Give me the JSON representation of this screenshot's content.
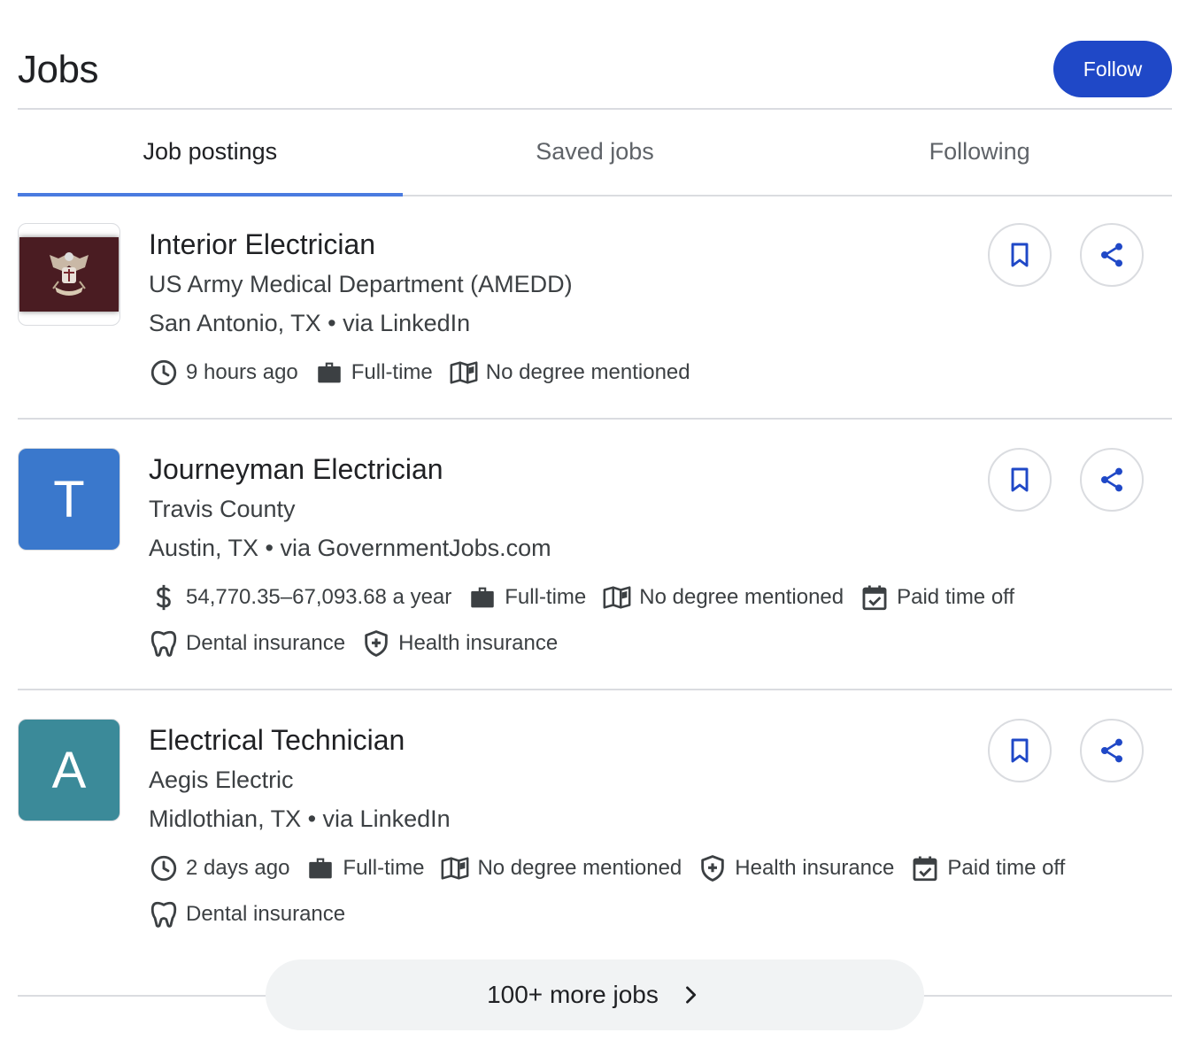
{
  "header": {
    "title": "Jobs",
    "follow_label": "Follow"
  },
  "tabs": [
    {
      "label": "Job postings",
      "active": true
    },
    {
      "label": "Saved jobs",
      "active": false
    },
    {
      "label": "Following",
      "active": false
    }
  ],
  "jobs": [
    {
      "title": "Interior Electrician",
      "company": "US Army Medical Department (AMEDD)",
      "location": "San Antonio, TX • via LinkedIn",
      "logo": {
        "type": "image",
        "icon": "army-crest-logo"
      },
      "chips_row1": [
        {
          "icon": "clock-icon",
          "text": "9 hours ago"
        },
        {
          "icon": "briefcase-icon",
          "text": "Full-time"
        },
        {
          "icon": "book-icon",
          "text": "No degree mentioned"
        }
      ],
      "chips_row2": []
    },
    {
      "title": "Journeyman Electrician",
      "company": "Travis County",
      "location": "Austin, TX • via GovernmentJobs.com",
      "logo": {
        "type": "letter",
        "letter": "T",
        "color": "#3a78cc"
      },
      "chips_row1": [
        {
          "icon": "dollar-icon",
          "text": "54,770.35–67,093.68 a year"
        },
        {
          "icon": "briefcase-icon",
          "text": "Full-time"
        },
        {
          "icon": "book-icon",
          "text": "No degree mentioned"
        },
        {
          "icon": "calendar-check-icon",
          "text": "Paid time off"
        }
      ],
      "chips_row2": [
        {
          "icon": "tooth-icon",
          "text": "Dental insurance"
        },
        {
          "icon": "shield-plus-icon",
          "text": "Health insurance"
        }
      ]
    },
    {
      "title": "Electrical Technician",
      "company": "Aegis Electric",
      "location": "Midlothian, TX • via LinkedIn",
      "logo": {
        "type": "letter",
        "letter": "A",
        "color": "#3b8a99"
      },
      "chips_row1": [
        {
          "icon": "clock-icon",
          "text": "2 days ago"
        },
        {
          "icon": "briefcase-icon",
          "text": "Full-time"
        },
        {
          "icon": "book-icon",
          "text": "No degree mentioned"
        },
        {
          "icon": "shield-plus-icon",
          "text": "Health insurance"
        },
        {
          "icon": "calendar-check-icon",
          "text": "Paid time off"
        }
      ],
      "chips_row2": [
        {
          "icon": "tooth-icon",
          "text": "Dental insurance"
        }
      ]
    }
  ],
  "more": {
    "label": "100+ more jobs",
    "icon": "chevron-right-icon"
  },
  "colors": {
    "accent": "#1f48c7",
    "tab_underline": "#4a7be0",
    "icon_blue": "#1f48c7"
  }
}
